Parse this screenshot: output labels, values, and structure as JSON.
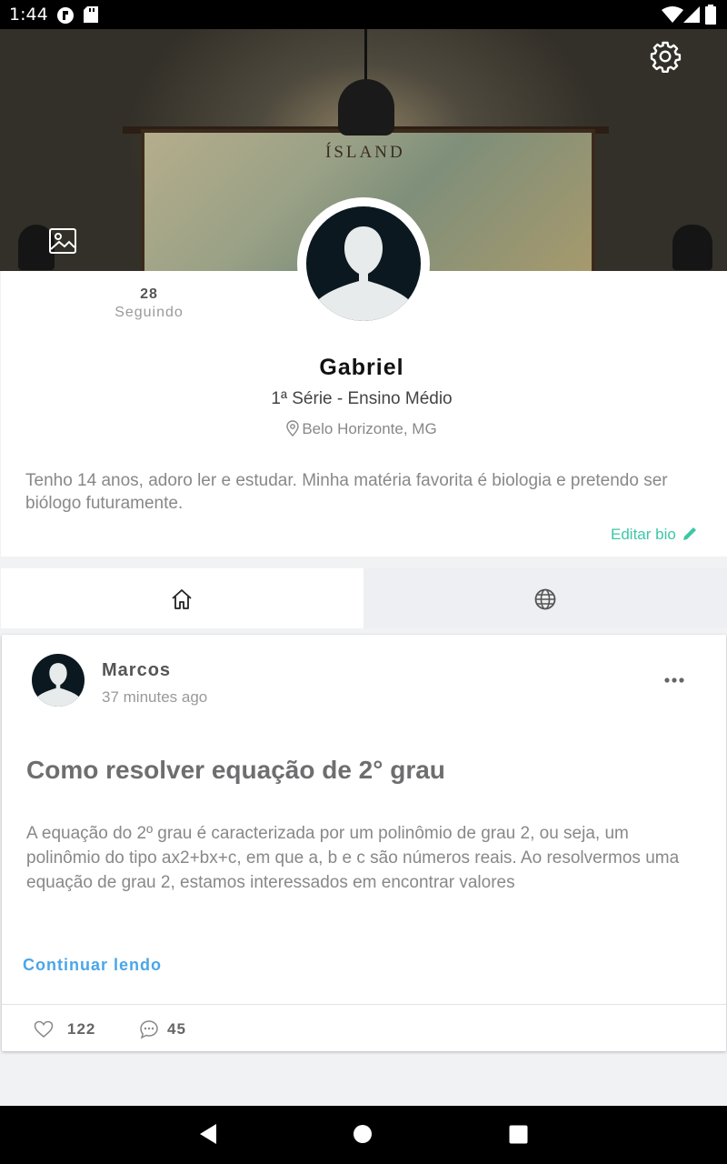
{
  "status_bar": {
    "time": "1:44"
  },
  "cover": {
    "map_title": "ÍSLAND"
  },
  "profile": {
    "following_count": "28",
    "following_label": "Seguindo",
    "name": "Gabriel",
    "grade": "1ª Série - Ensino Médio",
    "location": "Belo Horizonte, MG",
    "bio": "Tenho 14 anos, adoro ler e estudar. Minha matéria favorita é biologia e pretendo ser biólogo futuramente.",
    "edit_bio_label": "Editar bio"
  },
  "tabs": [
    "home-icon",
    "globe-icon"
  ],
  "post": {
    "author": "Marcos",
    "time": "37 minutes ago",
    "title": "Como resolver equação de 2° grau",
    "excerpt": "A equação do 2º grau é caracterizada por um polinômio de grau 2, ou seja, um polinômio do tipo ax2+bx+c, em que a, b e c são números reais. Ao resolvermos uma equação de grau 2, estamos interessados em encontrar valores",
    "read_more": "Continuar lendo",
    "likes": "122",
    "comments": "45"
  },
  "colors": {
    "accent_green": "#3cc7a6",
    "link_blue": "#4aa6e8"
  }
}
